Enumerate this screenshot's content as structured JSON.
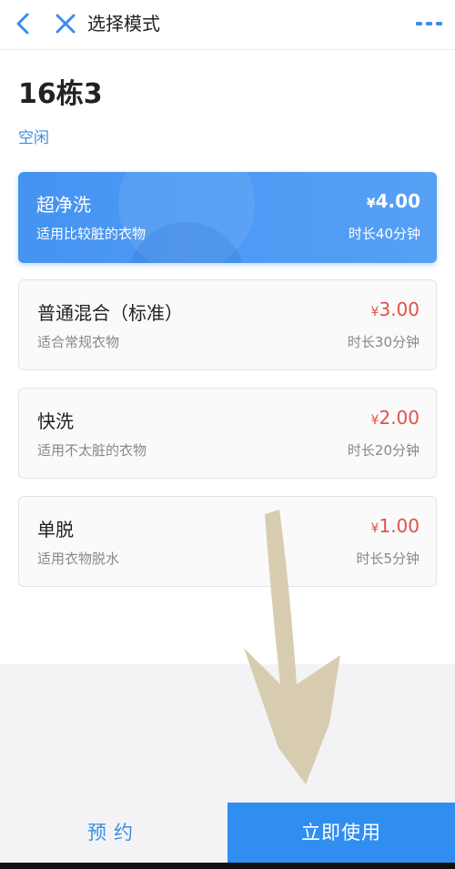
{
  "nav": {
    "title": "选择模式",
    "back_icon": "chevron-left-icon",
    "close_icon": "close-icon",
    "more_icon": "more-dots-icon",
    "accent_color": "#3a8ee6"
  },
  "machine": {
    "name": "16栋3",
    "status": "空闲"
  },
  "modes": [
    {
      "name": "超净洗",
      "desc": "适用比较脏的衣物",
      "currency": "¥",
      "price": "4.00",
      "duration": "时长40分钟",
      "selected": true
    },
    {
      "name": "普通混合（标准）",
      "desc": "适合常规衣物",
      "currency": "¥",
      "price": "3.00",
      "duration": "时长30分钟",
      "selected": false
    },
    {
      "name": "快洗",
      "desc": "适用不太脏的衣物",
      "currency": "¥",
      "price": "2.00",
      "duration": "时长20分钟",
      "selected": false
    },
    {
      "name": "单脱",
      "desc": "适用衣物脱水",
      "currency": "¥",
      "price": "1.00",
      "duration": "时长5分钟",
      "selected": false
    }
  ],
  "actions": {
    "reserve_label": "预约",
    "use_label": "立即使用"
  },
  "colors": {
    "selected_card": "#4593f2",
    "price_red": "#e0524a",
    "primary_button": "#2f8ef0",
    "overlay_arrow": "#d4c6a6"
  }
}
